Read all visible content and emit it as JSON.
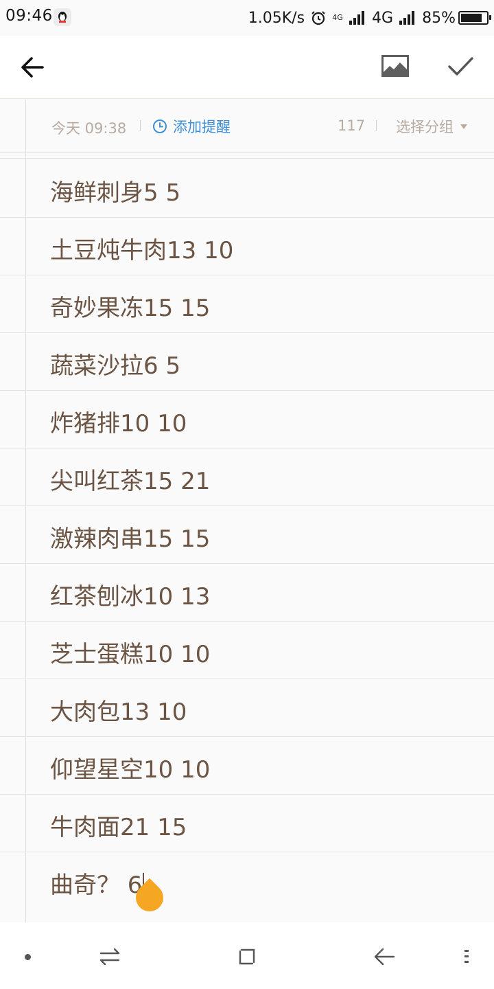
{
  "status_bar": {
    "time": "09:46",
    "network_speed": "1.05K/s",
    "network_type_small": "4G",
    "network_type": "4G",
    "battery_percent": "85%",
    "battery_level": 0.85
  },
  "meta": {
    "date": "今天 09:38",
    "reminder_label": "添加提醒",
    "char_count": "117",
    "group_label": "选择分组"
  },
  "note_lines": [
    "海鲜刺身5 5",
    "土豆炖牛肉13 10",
    "奇妙果冻15 15",
    "蔬菜沙拉6 5",
    "炸猪排10 10",
    "尖叫红茶15 21",
    "激辣肉串15 15",
    "红茶刨冰10 13",
    "芝士蛋糕10 10",
    "大肉包13 10",
    "仰望星空10 10",
    "牛肉面21 15"
  ],
  "editing_line": "曲奇？ 6",
  "colors": {
    "text": "#6b5443",
    "accent_blue": "#3e8fd6",
    "muted": "#b8aba0",
    "handle": "#f5a623"
  }
}
